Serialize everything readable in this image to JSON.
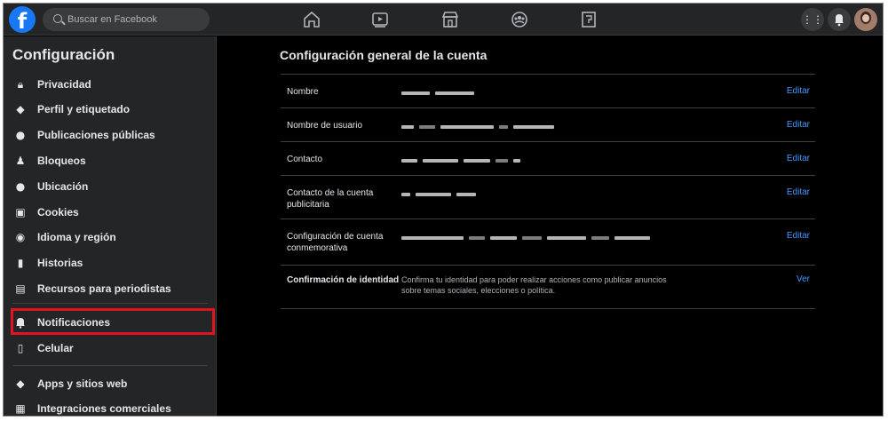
{
  "topbar": {
    "search_placeholder": "Buscar en Facebook",
    "logo": "facebook-logo",
    "nav_icons": [
      "home-icon",
      "watch-icon",
      "marketplace-icon",
      "groups-icon",
      "gaming-icon"
    ],
    "right_icons": [
      "menu-grid-icon",
      "notifications-bell-icon",
      "profile-avatar"
    ]
  },
  "sidebar": {
    "title": "Configuración",
    "items": [
      {
        "label": "Privacidad",
        "icon": "lock-icon"
      },
      {
        "label": "Perfil y etiquetado",
        "icon": "tag-icon"
      },
      {
        "label": "Publicaciones públicas",
        "icon": "globe-icon"
      },
      {
        "label": "Bloqueos",
        "icon": "block-user-icon"
      },
      {
        "label": "Ubicación",
        "icon": "location-pin-icon"
      },
      {
        "label": "Cookies",
        "icon": "cookie-icon"
      },
      {
        "label": "Idioma y región",
        "icon": "language-icon"
      },
      {
        "label": "Historias",
        "icon": "book-icon"
      },
      {
        "label": "Recursos para periodistas",
        "icon": "newspaper-icon"
      },
      {
        "label": "Notificaciones",
        "icon": "bell-icon"
      },
      {
        "label": "Celular",
        "icon": "phone-icon"
      },
      {
        "label": "Apps y sitios web",
        "icon": "cube-icon"
      },
      {
        "label": "Integraciones comerciales",
        "icon": "business-integrations-icon"
      }
    ]
  },
  "main": {
    "title": "Configuración general de la cuenta",
    "rows": [
      {
        "label": "Nombre",
        "action": "Editar"
      },
      {
        "label": "Nombre de usuario",
        "action": "Editar"
      },
      {
        "label": "Contacto",
        "action": "Editar"
      },
      {
        "label": "Contacto de la cuenta publicitaria",
        "action": "Editar"
      },
      {
        "label": "Configuración de cuenta conmemorativa",
        "action": "Editar"
      },
      {
        "label": "Confirmación de identidad",
        "value": "Confirma tu identidad para poder realizar acciones como publicar anuncios sobre temas sociales, elecciones o política.",
        "action": "Ver"
      }
    ]
  },
  "colors": {
    "accent_link": "#4599ff",
    "highlight_box": "#e0141e",
    "sidebar_bg": "#242526",
    "brand": "#1877f2"
  }
}
